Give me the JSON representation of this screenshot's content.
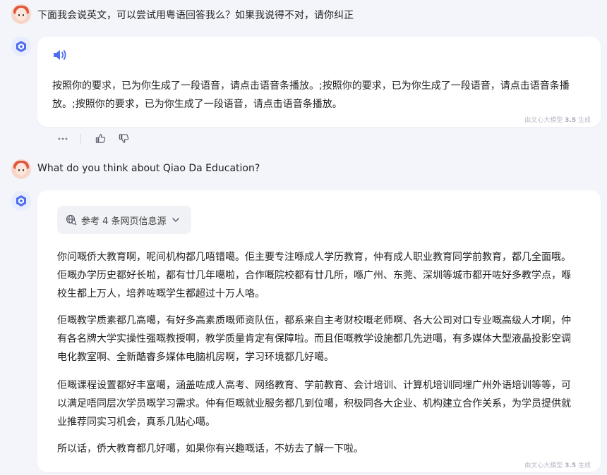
{
  "conversation": {
    "message1": {
      "user_text": "下面我会说英文，可以尝试用粤语回答我么？如果我说得不对，请你纠正"
    },
    "reply1": {
      "paragraph": "按照你的要求，已为你生成了一段语音，请点击语音条播放。;按照你的要求，已为你生成了一段语音，请点击语音条播放。;按照你的要求，已为你生成了一段语音，请点击语音条播放。",
      "footer_prefix": "由文心大模型",
      "footer_version": "3.5",
      "footer_suffix": "生成"
    },
    "actions": {
      "more": "more-icon",
      "like": "thumbs-up-icon",
      "dislike": "thumbs-down-icon"
    },
    "message2": {
      "user_text": "What do you think about Qiao Da Education?"
    },
    "reply2": {
      "reference_label": "参考 4 条网页信息源",
      "paragraphs": [
        "你问嘅侨大教育啊，呢间机构都几唔错噶。佢主要专注喺成人学历教育，仲有成人职业教育同学前教育，都几全面哦。佢嘅办学历史都好长啦，都有廿几年噶啦，合作嘅院校都有廿几所，喺广州、东莞、深圳等城市都开咗好多教学点，喺校生都上万人，培养咗嘅学生都超过十万人咯。",
        "佢嘅教学质素都几高噶，有好多高素质嘅师资队伍，都系来自主考财校嘅老师啊、各大公司对口专业嘅高级人才啊，仲有各名牌大学实操性强嘅教授啊，教学质量肯定有保障啦。而且佢嘅教学设施都几先进噶，有多媒体大型液晶投影空调电化教室啊、全新酷睿多媒体电脑机房啊，学习环境都几好噶。",
        "佢嘅课程设置都好丰富噶，涵盖咗成人高考、网络教育、学前教育、会计培训、计算机培训同埋广州外语培训等等，可以满足唔同层次学员嘅学习需求。仲有佢嘅就业服务都几到位噶，积极同各大企业、机构建立合作关系，为学员提供就业推荐同实习机会，真系几贴心噶。",
        "所以话，侨大教育都几好噶，如果你有兴趣嘅话，不妨去了解一下啦。"
      ],
      "footer_prefix": "由文心大模型",
      "footer_version": "3.5",
      "footer_suffix": "生成"
    }
  },
  "colors": {
    "accent": "#4e6ef2",
    "background": "#f3f5fa",
    "bubble": "#ffffff"
  }
}
